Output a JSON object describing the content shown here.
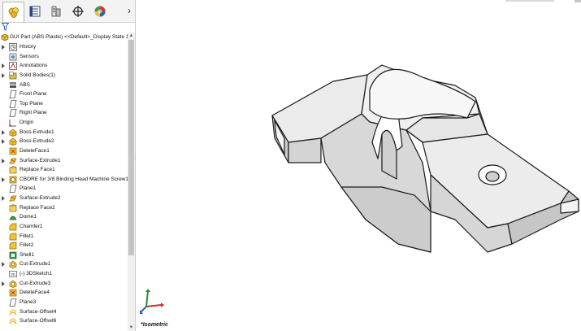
{
  "tabs": [
    {
      "name": "featuremanager",
      "icon": "feature-tree-icon"
    },
    {
      "name": "propertymanager",
      "icon": "property-manager-icon"
    },
    {
      "name": "configurationmanager",
      "icon": "configuration-manager-icon"
    },
    {
      "name": "dimxpert",
      "icon": "dimxpert-icon"
    },
    {
      "name": "display",
      "icon": "display-manager-icon"
    }
  ],
  "tabs_more": "›",
  "tree_root": "GUI Part (ABS Plastic) <<Default>_Display State 1>",
  "tree_items": [
    {
      "label": "History",
      "icon": "history-icon",
      "expandable": true
    },
    {
      "label": "Sensors",
      "icon": "sensor-icon",
      "expandable": false
    },
    {
      "label": "Annotations",
      "icon": "annotation-icon",
      "expandable": true
    },
    {
      "label": "Solid Bodies(1)",
      "icon": "solid-bodies-icon",
      "expandable": true
    },
    {
      "label": "ABS",
      "icon": "material-icon",
      "expandable": false
    },
    {
      "label": "Front Plane",
      "icon": "plane-icon",
      "expandable": false
    },
    {
      "label": "Top Plane",
      "icon": "plane-icon",
      "expandable": false
    },
    {
      "label": "Right Plane",
      "icon": "plane-icon",
      "expandable": false
    },
    {
      "label": "Origin",
      "icon": "origin-icon",
      "expandable": false
    },
    {
      "label": "Boss-Extrude1",
      "icon": "boss-extrude-icon",
      "expandable": true
    },
    {
      "label": "Boss-Extrude2",
      "icon": "boss-extrude-icon",
      "expandable": true
    },
    {
      "label": "DeleteFace1",
      "icon": "delete-face-icon",
      "expandable": false
    },
    {
      "label": "Surface-Extrude1",
      "icon": "surface-extrude-icon",
      "expandable": true
    },
    {
      "label": "Replace Face1",
      "icon": "replace-face-icon",
      "expandable": false
    },
    {
      "label": "CBORE for 3/8 Binding Head Machine Screw1",
      "icon": "hole-wizard-icon",
      "expandable": true
    },
    {
      "label": "Plane1",
      "icon": "plane-icon",
      "expandable": false
    },
    {
      "label": "Surface-Extrude2",
      "icon": "surface-extrude-icon",
      "expandable": true
    },
    {
      "label": "Replace Face2",
      "icon": "replace-face-icon",
      "expandable": false
    },
    {
      "label": "Dome1",
      "icon": "dome-icon",
      "expandable": false
    },
    {
      "label": "Chamfer1",
      "icon": "chamfer-icon",
      "expandable": false
    },
    {
      "label": "Fillet1",
      "icon": "fillet-icon",
      "expandable": false
    },
    {
      "label": "Fillet2",
      "icon": "fillet-icon",
      "expandable": false
    },
    {
      "label": "Shell1",
      "icon": "shell-icon",
      "expandable": false
    },
    {
      "label": "Cut-Extrude1",
      "icon": "cut-extrude-icon",
      "expandable": true
    },
    {
      "label": "(-) 3DSketch1",
      "icon": "sketch-3d-icon",
      "expandable": false
    },
    {
      "label": "Cut-Extrude3",
      "icon": "cut-extrude-icon",
      "expandable": true
    },
    {
      "label": "DeleteFace4",
      "icon": "delete-face-icon",
      "expandable": false
    },
    {
      "label": "Plane3",
      "icon": "plane-icon",
      "expandable": false
    },
    {
      "label": "Surface-Offset4",
      "icon": "surface-offset-icon",
      "expandable": false
    },
    {
      "label": "Surface-Offset6",
      "icon": "surface-offset-icon",
      "expandable": false
    }
  ],
  "view_orientation": "*Isometric",
  "triad_axes": [
    "x",
    "y",
    "z"
  ],
  "colors": {
    "panel_bg": "#ffffff",
    "tabbar_bg": "#f3f3f3",
    "feature_yellow": "#f2c230",
    "model_face": "#e8e8e8",
    "model_edge": "#1a1a1a"
  }
}
